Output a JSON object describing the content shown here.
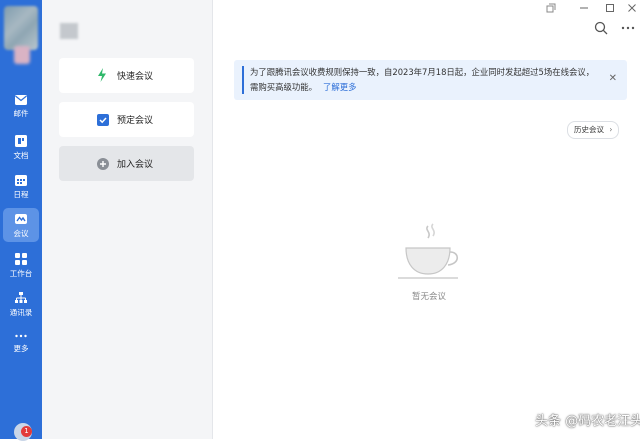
{
  "window": {
    "controls": [
      "restore-icon",
      "minimize-icon",
      "maximize-icon",
      "close-icon"
    ],
    "search_icon": "search-icon",
    "more_icon": "more-icon"
  },
  "rail": {
    "items": [
      {
        "label": "邮件",
        "icon": "mail-icon"
      },
      {
        "label": "文档",
        "icon": "document-icon"
      },
      {
        "label": "日程",
        "icon": "calendar-icon"
      },
      {
        "label": "会议",
        "icon": "meeting-icon",
        "active": true
      },
      {
        "label": "工作台",
        "icon": "workbench-icon"
      },
      {
        "label": "通讯录",
        "icon": "contacts-icon"
      },
      {
        "label": "更多",
        "icon": "more-dots-icon"
      }
    ],
    "badge": "1"
  },
  "actions": [
    {
      "label": "快速会议",
      "icon": "lightning-icon"
    },
    {
      "label": "预定会议",
      "icon": "checkbox-icon"
    },
    {
      "label": "加入会议",
      "icon": "plus-circle-icon"
    }
  ],
  "notice": {
    "text": "为了跟腾讯会议收费规则保持一致，自2023年7月18日起，企业同时发起超过5场在线会议，需购买高级功能。",
    "link": "了解更多"
  },
  "history_button": "历史会议",
  "empty_state": "暂无会议",
  "watermark": "头条 @码农老汪头",
  "colors": {
    "accent": "#2d6fd8",
    "rail": "#2d6fd8",
    "notice_bg": "#eaf2fd"
  }
}
